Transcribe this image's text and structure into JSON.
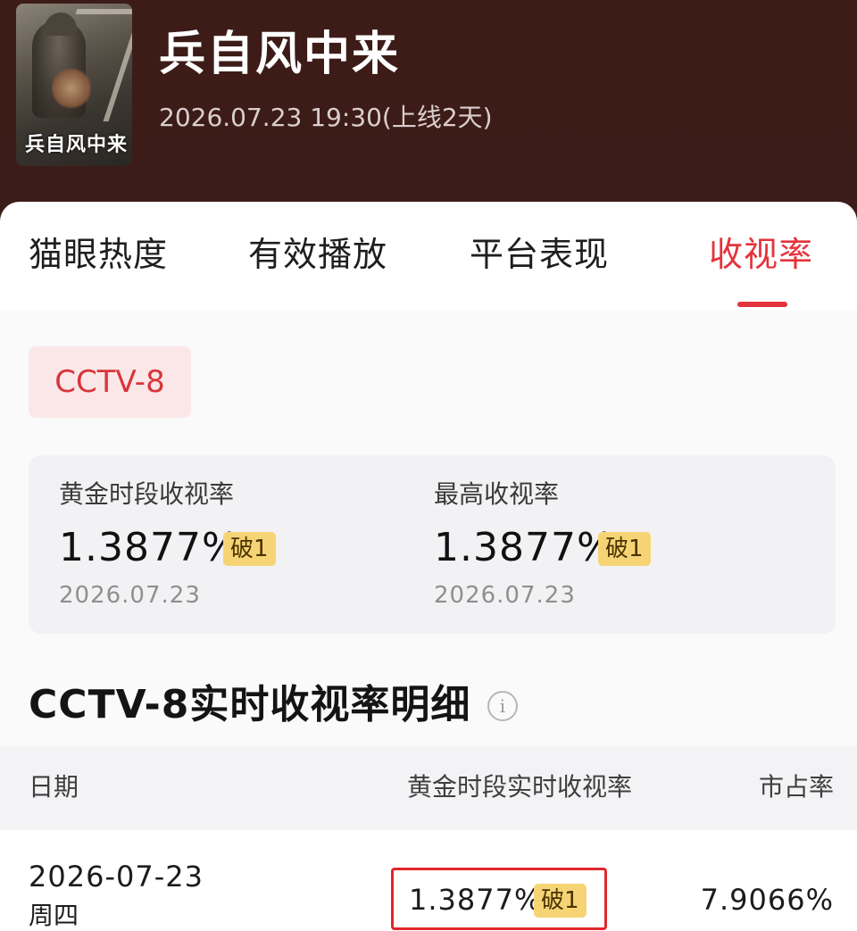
{
  "header": {
    "poster_title": "兵自风中来",
    "title": "兵自风中来",
    "subtitle": "2026.07.23 19:30(上线2天)"
  },
  "tabs": [
    {
      "label": "猫眼热度",
      "active": false
    },
    {
      "label": "有效播放",
      "active": false
    },
    {
      "label": "平台表现",
      "active": false
    },
    {
      "label": "收视率",
      "active": true
    }
  ],
  "channel": "CCTV-8",
  "stats": [
    {
      "label": "黄金时段收视率",
      "value": "1.3877%",
      "badge": "破1",
      "date": "2026.07.23"
    },
    {
      "label": "最高收视率",
      "value": "1.3877%",
      "badge": "破1",
      "date": "2026.07.23"
    }
  ],
  "detail": {
    "title": "CCTV-8实时收视率明细",
    "info_icon": "info-icon",
    "columns": [
      "日期",
      "黄金时段实时收视率",
      "市占率"
    ],
    "rows": [
      {
        "date": "2026-07-23",
        "weekday": "周四",
        "rating": "1.3877%",
        "badge": "破1",
        "share": "7.9066%"
      }
    ]
  },
  "colors": {
    "header_bg": "#3a1a17",
    "accent": "#e3343c",
    "badge_bg": "#f6d475",
    "chip_bg": "#fbe7e7"
  }
}
